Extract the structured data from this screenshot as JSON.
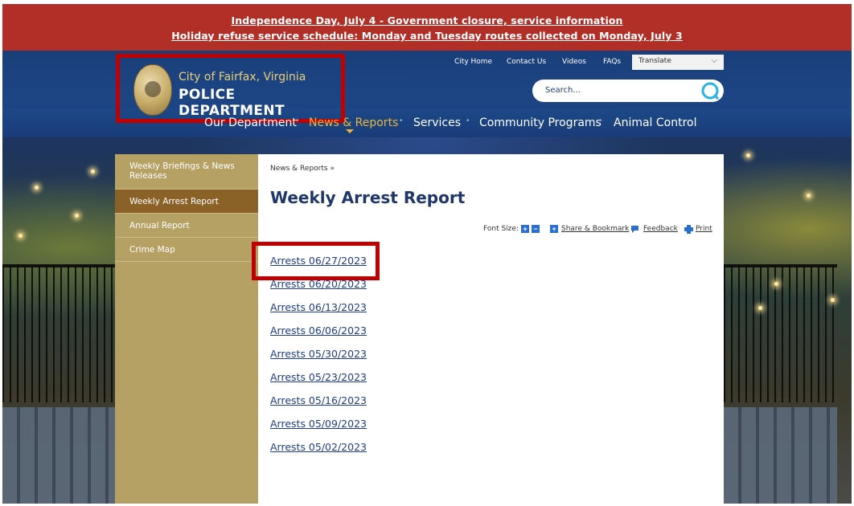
{
  "alert": {
    "line1": "Independence Day, July 4 - Government closure, service information",
    "line2": "Holiday refuse service schedule: Monday and Tuesday routes collected on Monday, July 3"
  },
  "logo": {
    "city": "City of Fairfax, Virginia",
    "department": "POLICE DEPARTMENT"
  },
  "utility_nav": [
    "City Home",
    "Contact Us",
    "Videos",
    "FAQs"
  ],
  "translate": {
    "label": "Translate"
  },
  "search": {
    "placeholder": "Search..."
  },
  "main_nav": [
    {
      "label": "Our Department"
    },
    {
      "label": "News & Reports",
      "active": true
    },
    {
      "label": "Services"
    },
    {
      "label": "Community Programs"
    },
    {
      "label": "Animal Control"
    }
  ],
  "sidebar": {
    "items": [
      {
        "label": "Weekly Briefings & News Releases"
      },
      {
        "label": "Weekly Arrest Report",
        "active": true
      },
      {
        "label": "Annual Report"
      },
      {
        "label": "Crime Map"
      }
    ]
  },
  "breadcrumb": {
    "label": "News & Reports",
    "separator": "»"
  },
  "page": {
    "title": "Weekly Arrest Report"
  },
  "tools": {
    "font_size_label": "Font Size:",
    "increase": "+",
    "decrease": "−",
    "share": "Share & Bookmark",
    "feedback": "Feedback",
    "print": "Print"
  },
  "arrests": [
    "Arrests 06/27/2023",
    "Arrests 06/20/2023",
    "Arrests 06/13/2023",
    "Arrests 06/06/2023",
    "Arrests 05/30/2023",
    "Arrests 05/23/2023",
    "Arrests 05/16/2023",
    "Arrests 05/09/2023",
    "Arrests 05/02/2023"
  ],
  "colors": {
    "alert_bg": "#b22f28",
    "header_bg": "#1d4584",
    "nav_active": "#e7b73b",
    "sidebar_bg": "#b5a163",
    "sidebar_active": "#8a6227",
    "title": "#1e3768",
    "link": "#1e3d8f",
    "highlight_box": "#c00000"
  },
  "icons": {
    "search": "search-icon",
    "chevron": "chevron-down-icon",
    "share": "plus-square-icon",
    "feedback": "speech-bubble-icon",
    "print": "printer-icon"
  }
}
